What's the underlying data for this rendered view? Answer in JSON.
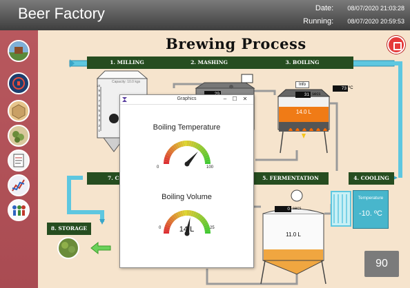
{
  "header": {
    "app_title": "Beer Factory",
    "date_label": "Date:",
    "date_value": "08/07/2020 21:03:28",
    "running_label": "Running:",
    "running_value": "08/07/2020 20:59:53"
  },
  "sidebar": {
    "items": [
      {
        "name": "farm",
        "color": "#5c8a3a"
      },
      {
        "name": "brew-tank",
        "color": "#c0392b"
      },
      {
        "name": "box",
        "color": "#c9a065"
      },
      {
        "name": "hops",
        "color": "#6b8c3a"
      },
      {
        "name": "report",
        "color": "#e8e8e8"
      },
      {
        "name": "chart",
        "color": "#d8d8e8"
      },
      {
        "name": "workers",
        "color": "#e8e0d0"
      }
    ]
  },
  "process": {
    "title": "Brewing Process",
    "steps": {
      "milling": "1. MILLING",
      "mashing": "2. MASHING",
      "boiling": "3. BOILING",
      "cooling": "4. COOLING",
      "fermentation": "5. FERMENTATION",
      "step7": "7. C",
      "storage": "8. STORAGE"
    },
    "mill_capacity": "Capacity: 10.0 kgs",
    "mill_scale": [
      "10",
      "9",
      "8",
      "7",
      "6",
      "5",
      "4",
      "3",
      "2",
      "1"
    ],
    "mash_timer": "29",
    "boil_info_label": "Info",
    "boil_timer": "31",
    "boil_timer_unit": "secs",
    "boil_temp": "73",
    "boil_temp_unit": "ºC",
    "boil_volume": "14.0  L",
    "ferment_timer": "0",
    "ferment_timer_unit": "secs",
    "ferment_volume": "11.0  L",
    "temp_panel_label": "Temperature",
    "temp_panel_value": "-10.  ºC",
    "counter": "90",
    "colors": {
      "step_bg": "#264d20",
      "pipe": "#5ec7e0",
      "liquid": "#f0a640",
      "boil_liquid": "#f07b16"
    }
  },
  "dialog": {
    "title": "Graphics",
    "minimize": "–",
    "maximize": "☐",
    "close": "✕",
    "gauges": [
      {
        "title": "Boiling Temperature",
        "min": "0",
        "max": "100",
        "value": 73,
        "value_text": ""
      },
      {
        "title": "Boiling Volume",
        "min": "0",
        "max": "25",
        "value": 14,
        "value_text": "14 L"
      }
    ]
  }
}
